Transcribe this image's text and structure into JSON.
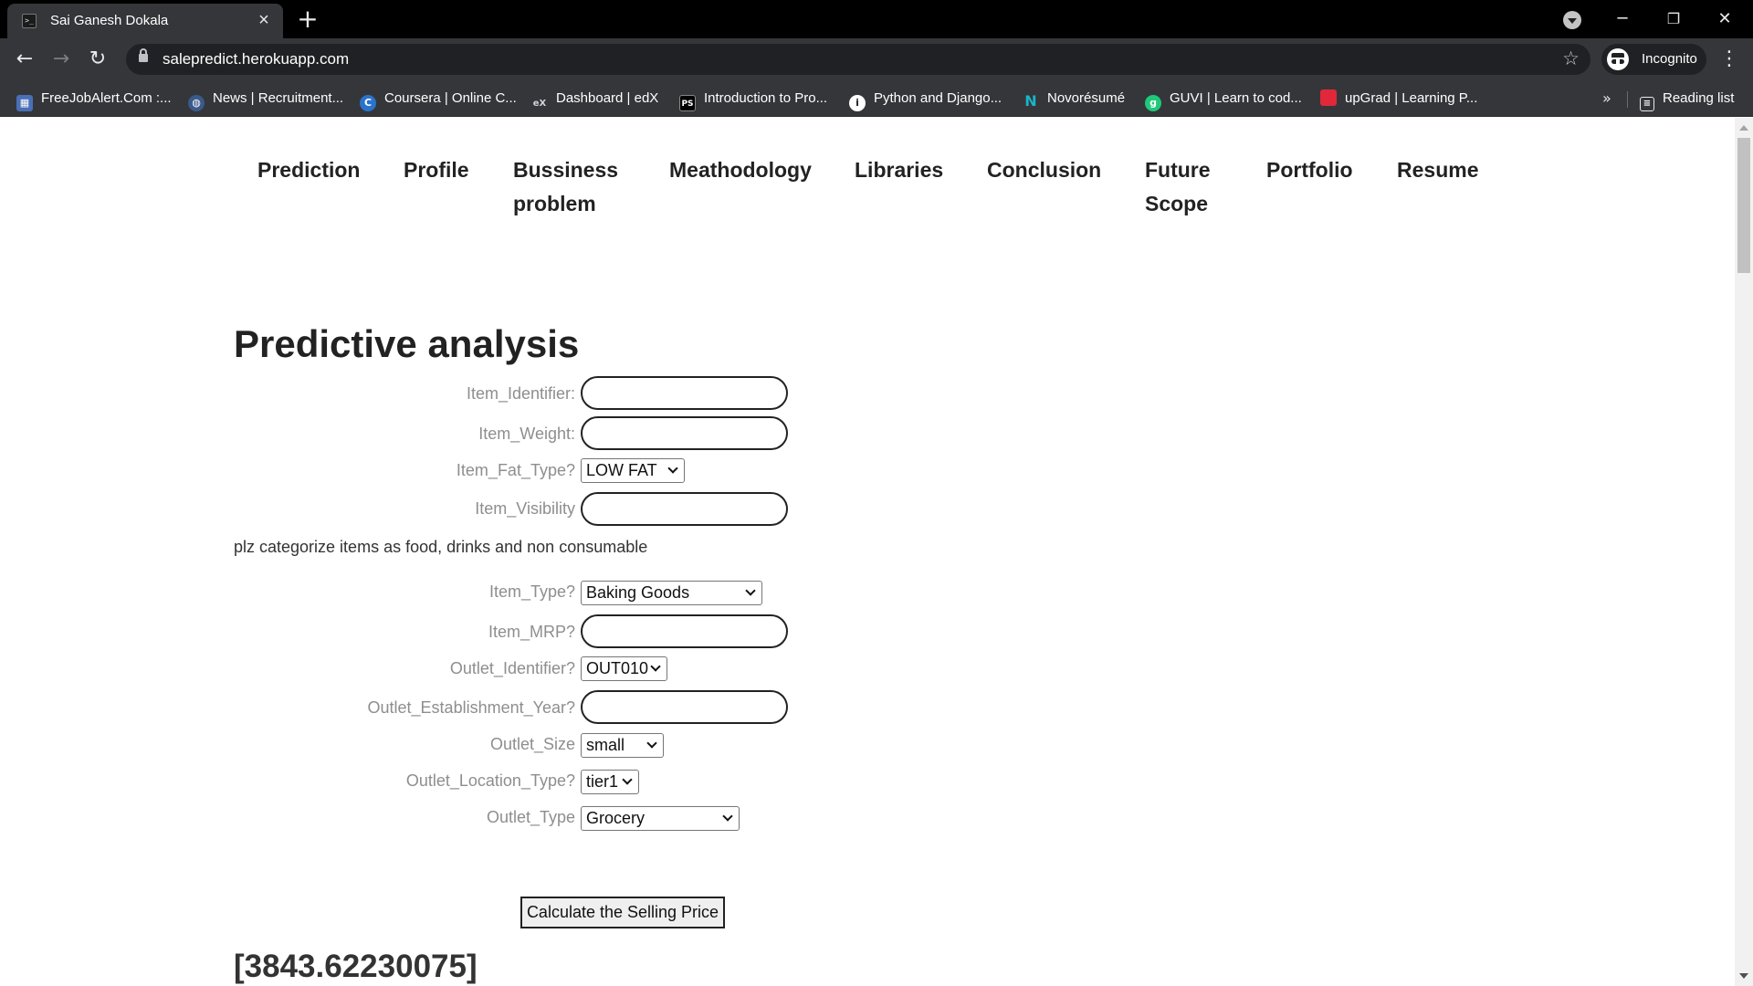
{
  "browser": {
    "tab_title": "Sai Ganesh Dokala",
    "url": "salepredict.herokuapp.com",
    "incognito_label": "Incognito",
    "reading_list_label": "Reading list",
    "bookmarks": [
      {
        "label": "FreeJobAlert.Com :...",
        "icon": "freejobalert-icon",
        "color": "#4a6fb5"
      },
      {
        "label": "News | Recruitment...",
        "icon": "globe-icon",
        "color": "#3a5a8a"
      },
      {
        "label": "Coursera | Online C...",
        "icon": "coursera-icon",
        "color": "#2a73cc"
      },
      {
        "label": "Dashboard | edX",
        "icon": "edx-icon",
        "color": "#35363a"
      },
      {
        "label": "Introduction to Pro...",
        "icon": "pycharm-icon",
        "color": "#000000"
      },
      {
        "label": "Python and Django...",
        "icon": "info-icon",
        "color": "#ffffff"
      },
      {
        "label": "Novorésumé",
        "icon": "novoresume-icon",
        "color": "#1ab4c9"
      },
      {
        "label": "GUVI | Learn to cod...",
        "icon": "guvi-icon",
        "color": "#1ec97a"
      },
      {
        "label": "upGrad | Learning P...",
        "icon": "upgrad-icon",
        "color": "#e0283a"
      }
    ]
  },
  "nav": [
    {
      "line1": "Prediction",
      "line2": ""
    },
    {
      "line1": "Profile",
      "line2": ""
    },
    {
      "line1": "Bussiness",
      "line2": "problem"
    },
    {
      "line1": "Meathodology",
      "line2": ""
    },
    {
      "line1": "Libraries",
      "line2": ""
    },
    {
      "line1": "Conclusion",
      "line2": ""
    },
    {
      "line1": "Future",
      "line2": "Scope"
    },
    {
      "line1": "Portfolio",
      "line2": ""
    },
    {
      "line1": "Resume",
      "line2": ""
    }
  ],
  "page": {
    "heading": "Predictive analysis",
    "note": "plz categorize items as food, drinks and non consumable",
    "button_label": "Calculate the Selling Price",
    "result": "[3843.62230075]"
  },
  "form": {
    "item_identifier": {
      "label": "Item_Identifier:",
      "value": ""
    },
    "item_weight": {
      "label": "Item_Weight:",
      "value": ""
    },
    "item_fat_type": {
      "label": "Item_Fat_Type?",
      "selected": "LOW FAT"
    },
    "item_visibility": {
      "label": "Item_Visibility",
      "value": ""
    },
    "item_type": {
      "label": "Item_Type?",
      "selected": "Baking Goods"
    },
    "item_mrp": {
      "label": "Item_MRP?",
      "value": ""
    },
    "outlet_identifier": {
      "label": "Outlet_Identifier?",
      "selected": "OUT010"
    },
    "outlet_establishment_year": {
      "label": "Outlet_Establishment_Year?",
      "value": ""
    },
    "outlet_size": {
      "label": "Outlet_Size",
      "selected": "small"
    },
    "outlet_location_type": {
      "label": "Outlet_Location_Type?",
      "selected": "tier1"
    },
    "outlet_type": {
      "label": "Outlet_Type",
      "selected": "Grocery"
    }
  }
}
